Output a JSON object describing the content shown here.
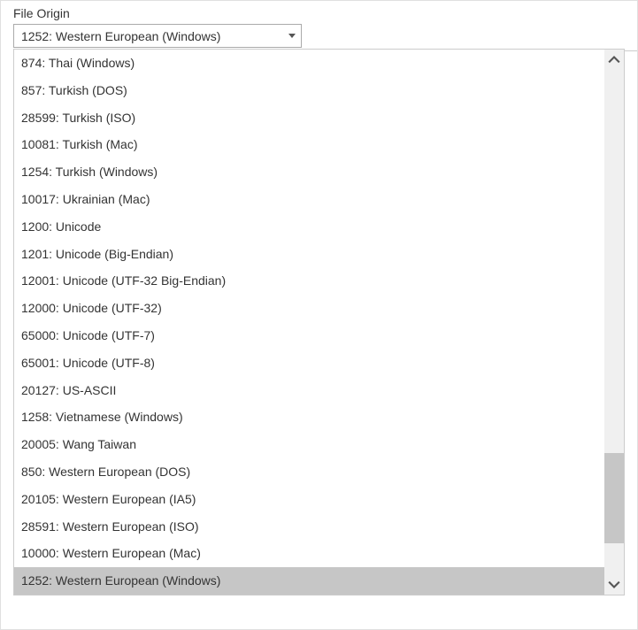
{
  "label": "File Origin",
  "selected": "1252: Western European (Windows)",
  "options": [
    "874: Thai (Windows)",
    "857: Turkish (DOS)",
    "28599: Turkish (ISO)",
    "10081: Turkish (Mac)",
    "1254: Turkish (Windows)",
    "10017: Ukrainian (Mac)",
    "1200: Unicode",
    "1201: Unicode (Big-Endian)",
    "12001: Unicode (UTF-32 Big-Endian)",
    "12000: Unicode (UTF-32)",
    "65000: Unicode (UTF-7)",
    "65001: Unicode (UTF-8)",
    "20127: US-ASCII",
    "1258: Vietnamese (Windows)",
    "20005: Wang Taiwan",
    "850: Western European (DOS)",
    "20105: Western European (IA5)",
    "28591: Western European (ISO)",
    "10000: Western European (Mac)",
    "1252: Western European (Windows)"
  ],
  "selectedIndex": 19
}
